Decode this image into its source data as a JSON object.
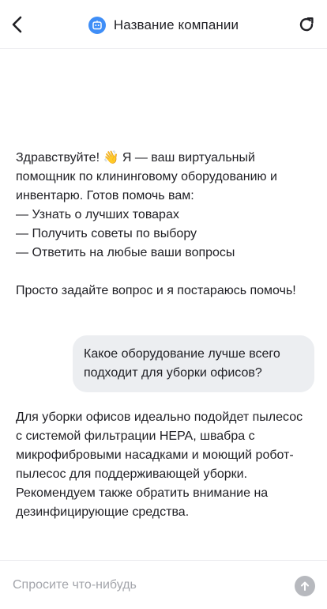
{
  "header": {
    "title": "Название компании",
    "back_icon": "chevron-left-icon",
    "avatar_icon": "bot-icon",
    "refresh_icon": "refresh-icon",
    "accent_color": "#3f8ef7"
  },
  "messages": [
    {
      "role": "bot",
      "text": "Здравствуйте! 👋 Я — ваш виртуальный помощник по клининговому оборудованию и инвентарю. Готов помочь вам:\n— Узнать о лучших товарах\n— Получить советы по выбору\n— Ответить на любые ваши вопросы\n\nПросто задайте вопрос и я постараюсь помочь!"
    },
    {
      "role": "user",
      "text": "Какое оборудование лучше всего подходит для уборки офисов?"
    },
    {
      "role": "bot",
      "text": "Для уборки офисов идеально подойдет пылесос с системой фильтрации HEPA, швабра с микрофибровыми насадками и моющий робот-пылесос для поддерживающей уборки. Рекомендуем также обратить внимание на дезинфицирующие средства."
    }
  ],
  "composer": {
    "placeholder": "Спросите что-нибудь",
    "value": "",
    "send_icon": "arrow-up-icon"
  }
}
